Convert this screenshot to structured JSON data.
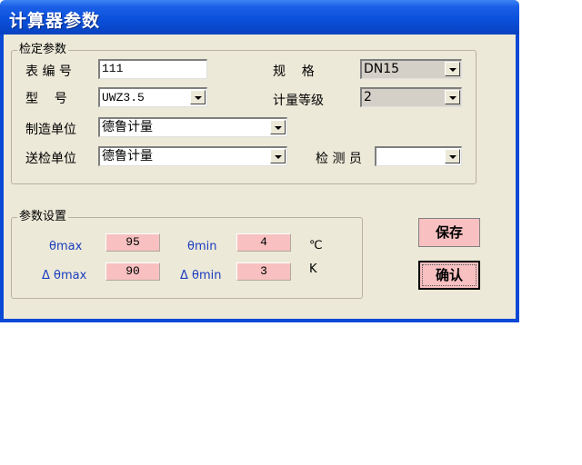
{
  "window": {
    "title": "计算器参数"
  },
  "group1": {
    "title": "检定参数",
    "meter_no": {
      "label": "表 编 号",
      "value": "111"
    },
    "spec": {
      "label": "规    格",
      "value": "DN15"
    },
    "model": {
      "label": "型    号",
      "value": "UWZ3.5"
    },
    "grade": {
      "label": "计量等级",
      "value": "2"
    },
    "manufacturer": {
      "label": "制造单位",
      "value": "德鲁计量"
    },
    "sender": {
      "label": "送检单位",
      "value": "德鲁计量"
    },
    "inspector": {
      "label": "检 测 员",
      "value": ""
    }
  },
  "group2": {
    "title": "参数设置",
    "theta_max": {
      "label": "θmax",
      "value": "95"
    },
    "theta_min": {
      "label": "θmin",
      "value": "4"
    },
    "dtheta_max": {
      "label": "Δ θmax",
      "value": "90"
    },
    "dtheta_min": {
      "label": "Δ θmin",
      "value": "3"
    },
    "unit_c": "℃",
    "unit_k": "K"
  },
  "buttons": {
    "save": "保存",
    "confirm": "确认"
  },
  "colors": {
    "title_bar": "#0a4fd9",
    "client_bg": "#ece9d8",
    "field_pink": "#f8c0c0",
    "param_label": "#1a3cc0"
  }
}
